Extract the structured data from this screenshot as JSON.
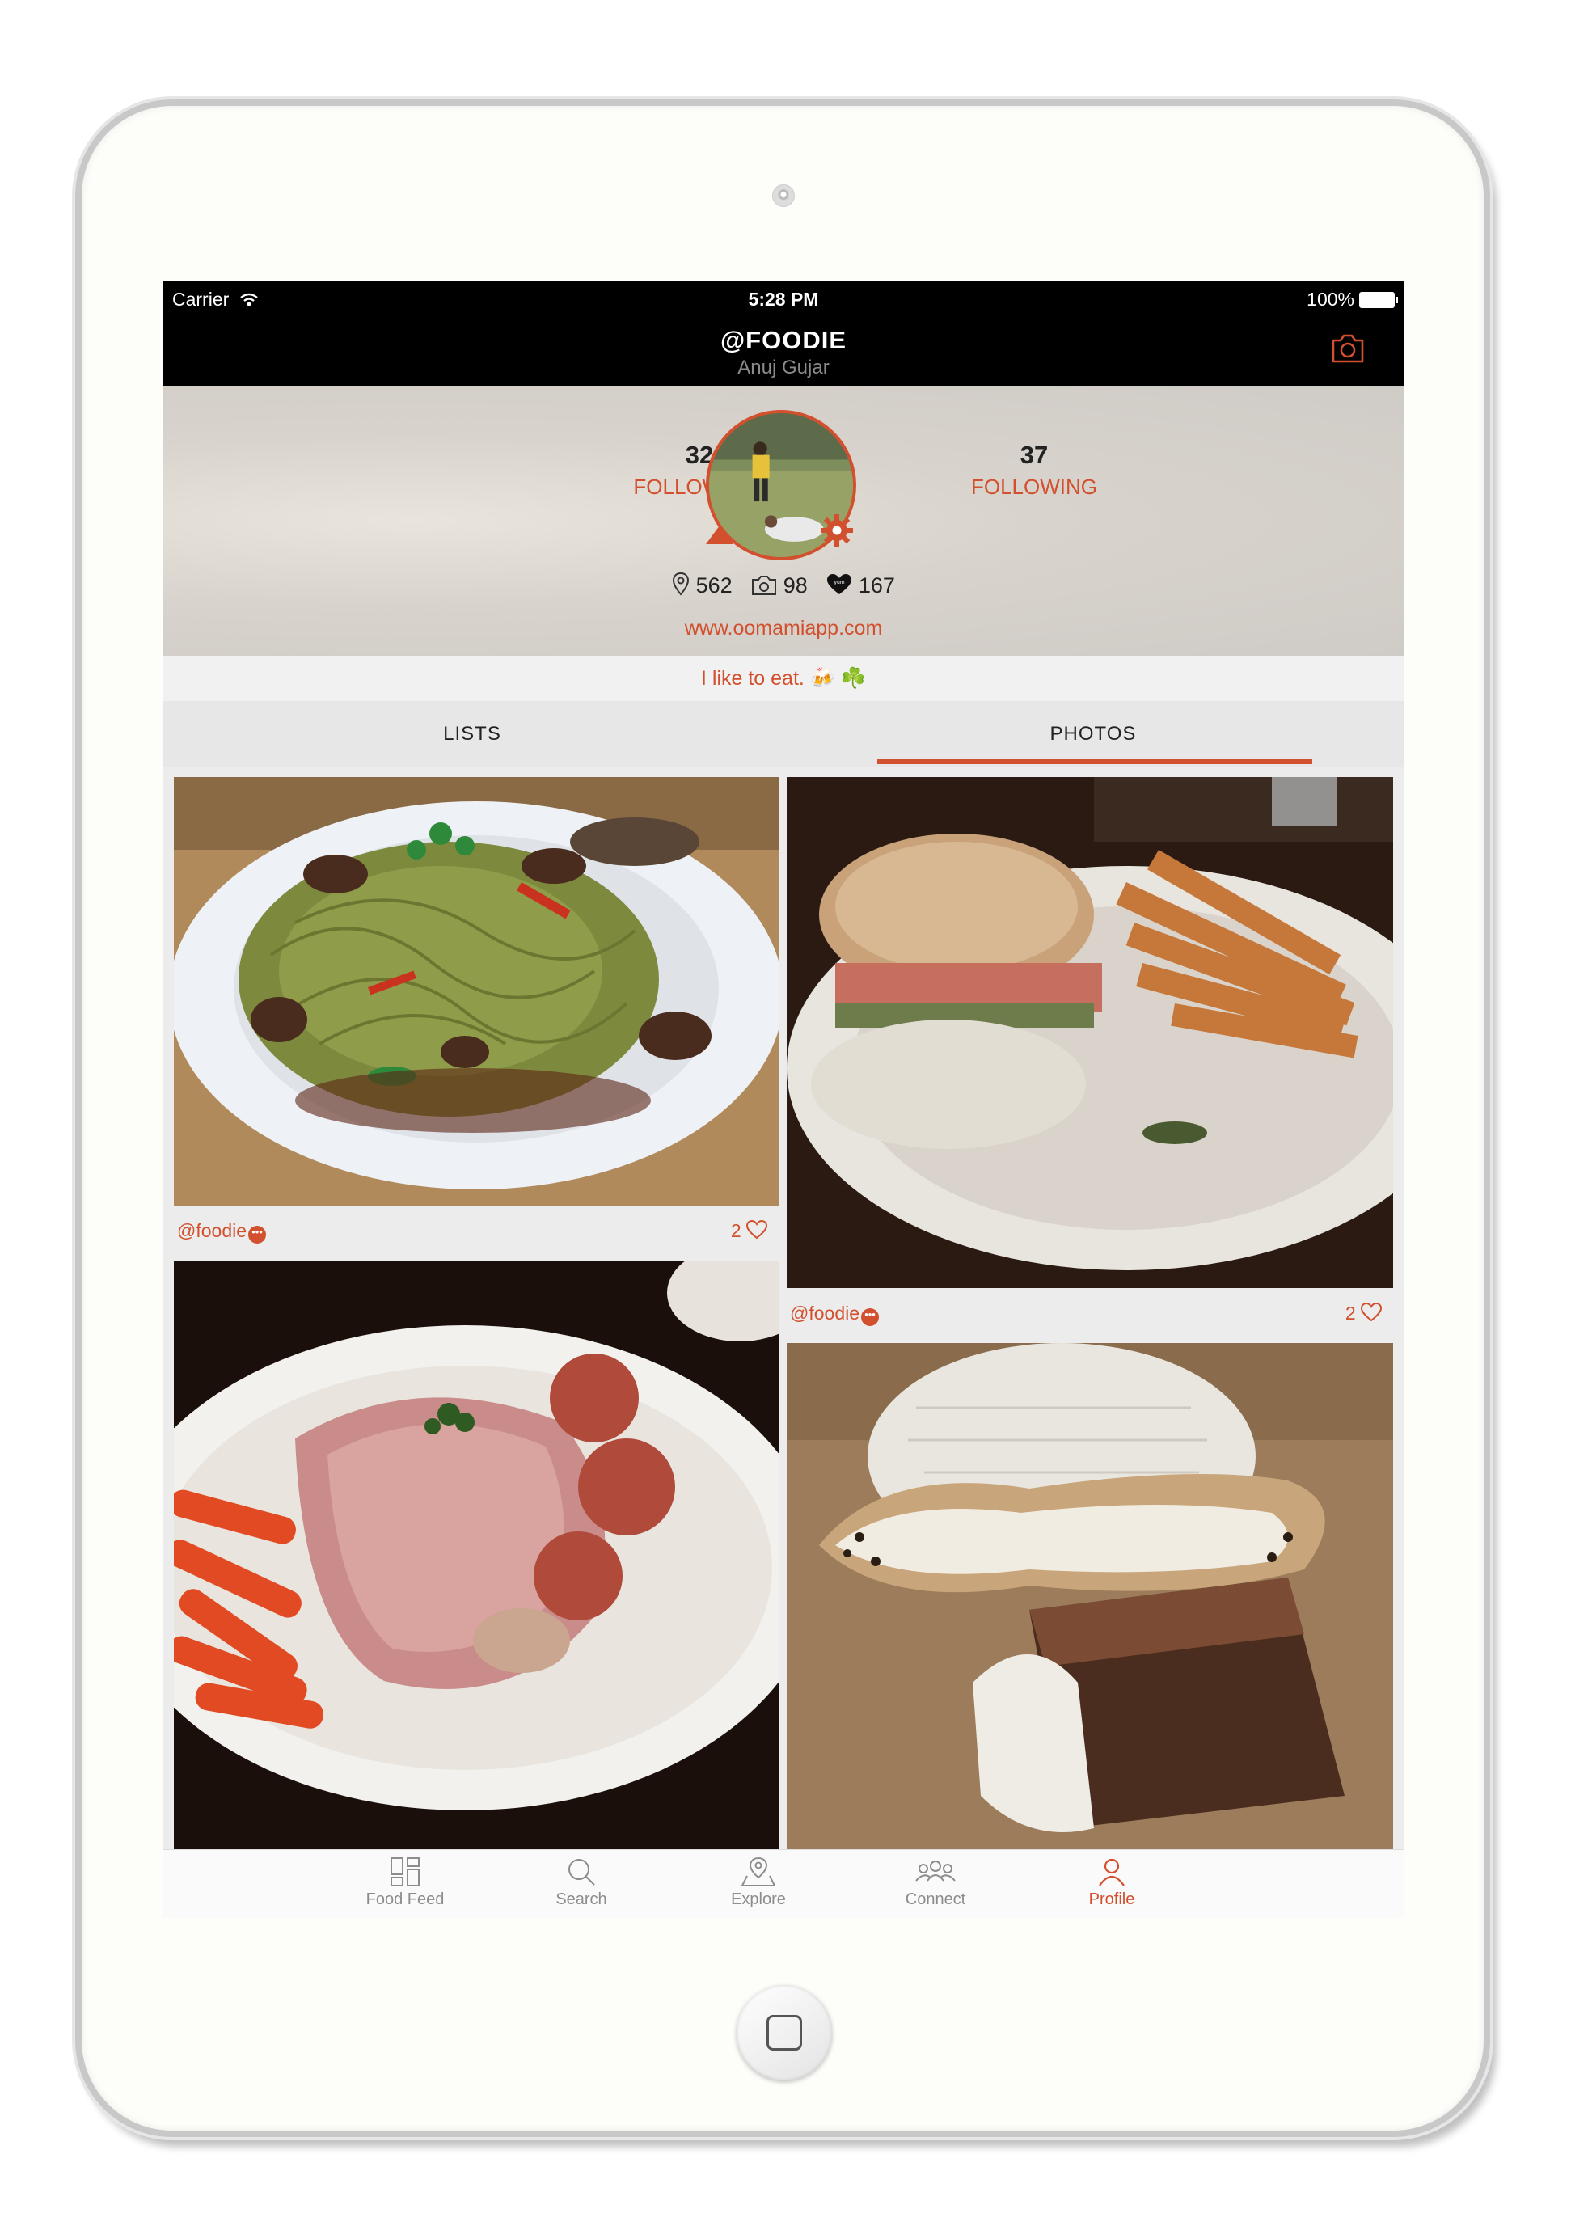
{
  "status_bar": {
    "carrier": "Carrier",
    "time": "5:28 PM",
    "battery": "100%"
  },
  "nav": {
    "handle": "@FOODIE",
    "name": "Anuj Gujar",
    "camera_icon": "camera-icon"
  },
  "profile": {
    "followers": {
      "count": "32",
      "label": "FOLLOWERS"
    },
    "following": {
      "count": "37",
      "label": "FOLLOWING"
    },
    "counts": {
      "places": "562",
      "photos": "98",
      "yums": "167"
    },
    "website": "www.oomamiapp.com",
    "bio": "I like to eat. 🍻 ☘️"
  },
  "tabs": {
    "lists": "LISTS",
    "photos": "PHOTOS",
    "active": "PHOTOS"
  },
  "photos": [
    {
      "user": "@foodie",
      "likes": "2",
      "subject": "noodles"
    },
    {
      "user": "@foodie",
      "likes": "2",
      "subject": "burger-and-fries"
    },
    {
      "user": "",
      "likes": "",
      "subject": "corned-beef"
    },
    {
      "user": "",
      "likes": "",
      "subject": "cannoli-and-tiramisu"
    }
  ],
  "tab_bar": [
    {
      "label": "Food Feed",
      "icon": "food-feed-icon"
    },
    {
      "label": "Search",
      "icon": "search-icon"
    },
    {
      "label": "Explore",
      "icon": "explore-icon"
    },
    {
      "label": "Connect",
      "icon": "connect-icon"
    },
    {
      "label": "Profile",
      "icon": "profile-icon",
      "active": true
    }
  ],
  "colors": {
    "accent": "#d2502e",
    "bar": "#000000"
  }
}
